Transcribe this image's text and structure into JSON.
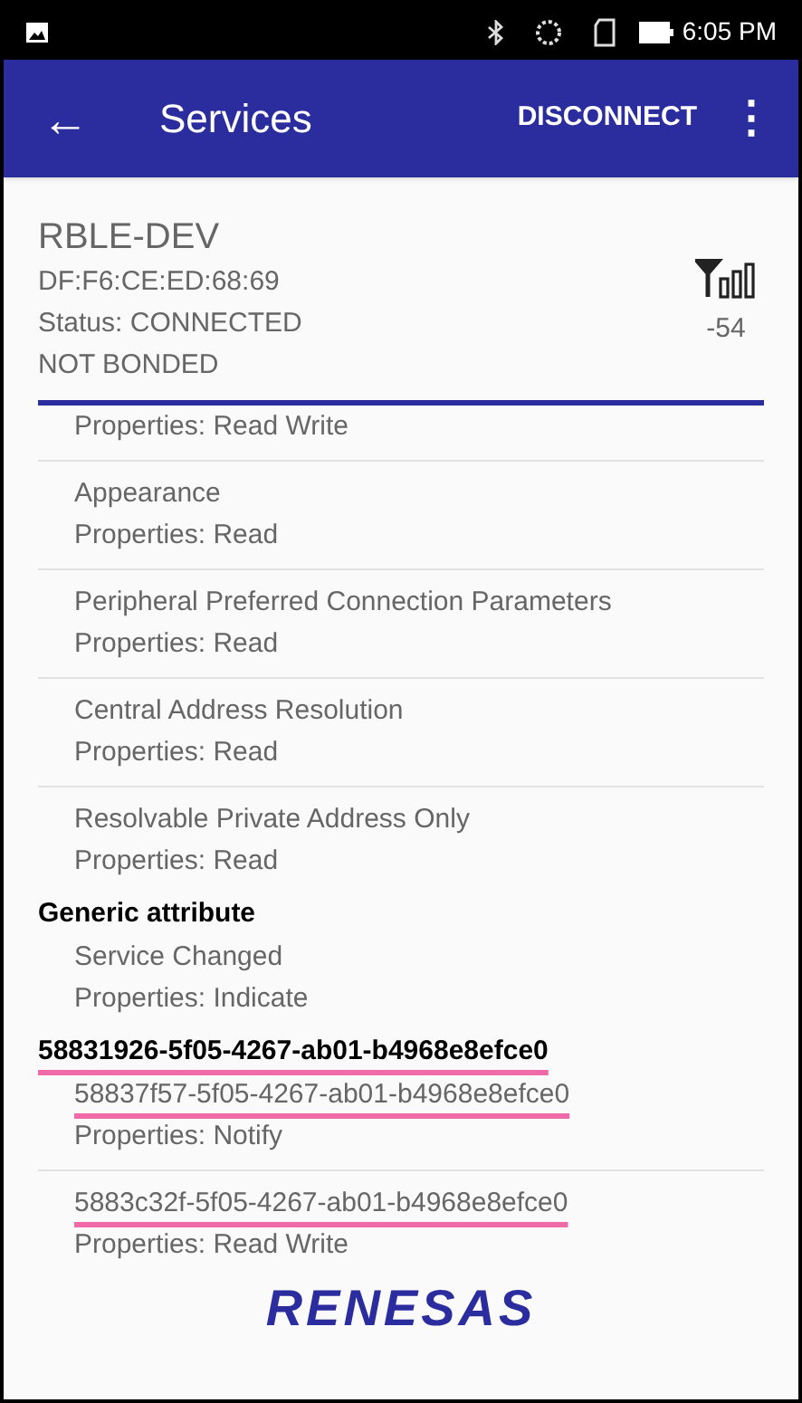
{
  "status_bar": {
    "time": "6:05 PM"
  },
  "app_bar": {
    "back": "←",
    "title": "Services",
    "action": "DISCONNECT",
    "menu": "⋮"
  },
  "device": {
    "name": "RBLE-DEV",
    "address": "DF:F6:CE:ED:68:69",
    "status": "Status:  CONNECTED",
    "bond": "NOT BONDED",
    "rssi": "-54"
  },
  "services": [
    {
      "characteristics": [
        {
          "properties": "Properties: Read Write"
        },
        {
          "name": "Appearance",
          "properties": "Properties: Read",
          "highlighted": false
        },
        {
          "name": "Peripheral Preferred Connection Parameters",
          "properties": "Properties: Read",
          "highlighted": false
        },
        {
          "name": "Central Address Resolution",
          "properties": "Properties: Read",
          "highlighted": false
        },
        {
          "name": "Resolvable Private Address Only",
          "properties": "Properties: Read",
          "highlighted": false
        }
      ]
    },
    {
      "name": "Generic attribute",
      "highlighted": false,
      "characteristics": [
        {
          "name": "Service Changed",
          "properties": "Properties: Indicate",
          "highlighted": false
        }
      ]
    },
    {
      "name": "58831926-5f05-4267-ab01-b4968e8efce0",
      "highlighted": true,
      "characteristics": [
        {
          "name": "58837f57-5f05-4267-ab01-b4968e8efce0",
          "properties": "Properties: Notify",
          "highlighted": true
        },
        {
          "name": "5883c32f-5f05-4267-ab01-b4968e8efce0",
          "properties": "Properties: Read Write",
          "highlighted": true
        }
      ]
    }
  ],
  "footer": {
    "logo": "RENESAS"
  }
}
